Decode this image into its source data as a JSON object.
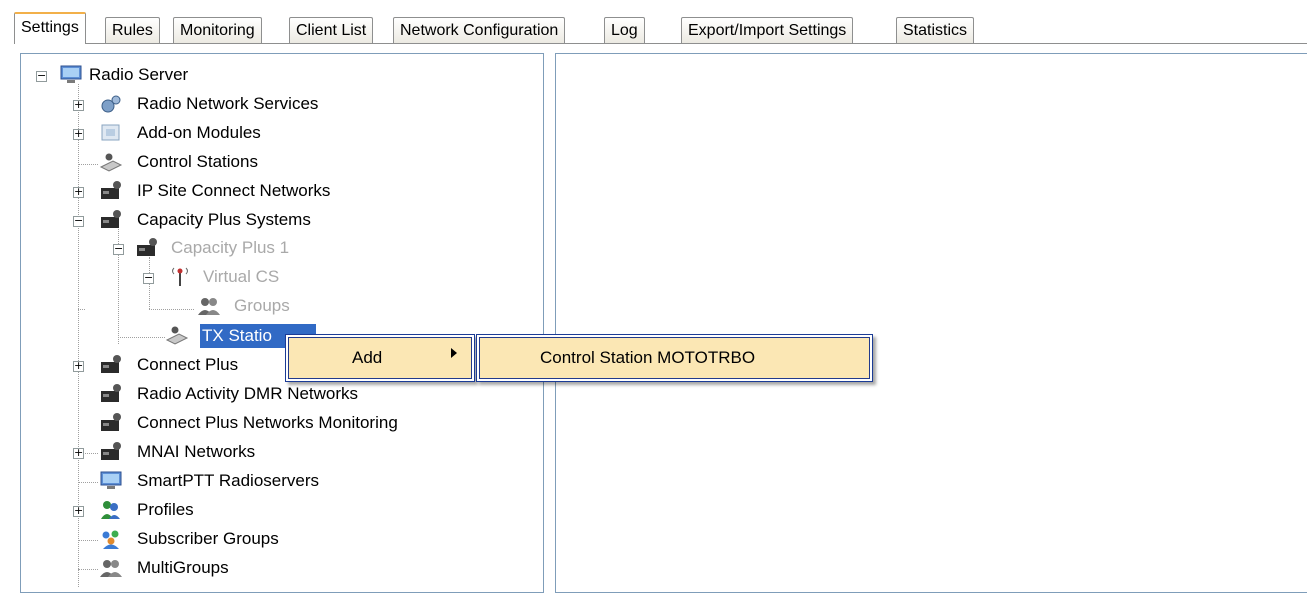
{
  "tabs": [
    {
      "label": "Settings",
      "active": true
    },
    {
      "label": "Rules"
    },
    {
      "label": "Monitoring"
    },
    {
      "label": "Client List"
    },
    {
      "label": "Network Configuration"
    },
    {
      "label": "Log"
    },
    {
      "label": "Export/Import Settings"
    },
    {
      "label": "Statistics"
    }
  ],
  "tree": {
    "root": "Radio Server",
    "items": [
      {
        "label": "Radio Network Services",
        "icon": "services-icon"
      },
      {
        "label": "Add-on Modules",
        "icon": "modules-icon"
      },
      {
        "label": "Control Stations",
        "icon": "control-station-icon"
      },
      {
        "label": "IP Site Connect Networks",
        "icon": "repeater-icon"
      },
      {
        "label": "Capacity Plus Systems",
        "icon": "repeater-icon"
      },
      {
        "label": "Capacity Plus 1",
        "icon": "repeater-icon"
      },
      {
        "label": "Virtual CS",
        "icon": "antenna-icon"
      },
      {
        "label": "Groups",
        "icon": "group-icon"
      },
      {
        "label": "TX Statio",
        "icon": "control-station-icon"
      },
      {
        "label": "Connect Plus",
        "icon": "repeater-icon"
      },
      {
        "label": "Radio Activity DMR Networks",
        "icon": "repeater-icon"
      },
      {
        "label": "Connect Plus Networks Monitoring",
        "icon": "repeater-icon"
      },
      {
        "label": "MNAI Networks",
        "icon": "repeater-icon"
      },
      {
        "label": "SmartPTT Radioservers",
        "icon": "server-icon"
      },
      {
        "label": "Profiles",
        "icon": "profiles-icon"
      },
      {
        "label": "Subscriber Groups",
        "icon": "subscriber-groups-icon"
      },
      {
        "label": "MultiGroups",
        "icon": "group-icon"
      }
    ]
  },
  "context_menu": {
    "add_label": "Add",
    "submenu_label": "Control Station MOTOTRBO"
  },
  "colors": {
    "selection": "#316ac5",
    "menu_highlight": "#fbe7b4",
    "tab_active_accent": "#f2b04a"
  }
}
